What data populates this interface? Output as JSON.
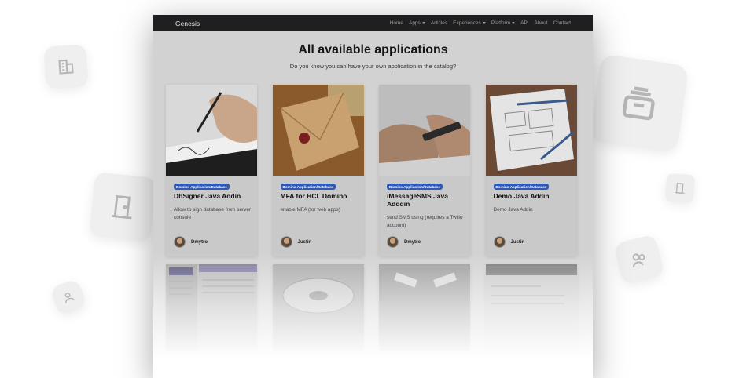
{
  "navbar": {
    "brand": "Genesis",
    "links": [
      {
        "label": "Home"
      },
      {
        "label": "Apps"
      },
      {
        "label": "Articles"
      },
      {
        "label": "Experiences"
      },
      {
        "label": "Platform"
      },
      {
        "label": "API"
      },
      {
        "label": "About"
      },
      {
        "label": "Contact"
      }
    ]
  },
  "hero": {
    "title": "All available applications",
    "subtitle": "Do you know you can have your own application in the catalog?"
  },
  "cards": [
    {
      "badge": "Domino Application/Database",
      "title": "DbSigner Java Addin",
      "description": "Allow to sign database from server console",
      "author": "Dmytro"
    },
    {
      "badge": "Domino Application/Database",
      "title": "MFA for HCL Domino",
      "description": "enable MFA (for web apps)",
      "author": "Justin"
    },
    {
      "badge": "Domino Application/Database",
      "title": "iMessageSMS Java Adddin",
      "description": "send SMS using (requires a Twilio account)",
      "author": "Dmytro"
    },
    {
      "badge": "Domino Application/Database",
      "title": "Demo Java Addin",
      "description": "Demo Java Addin",
      "author": "Justin"
    }
  ],
  "icons": {
    "tile_top_left": "building-icon",
    "tile_mid_left": "door-icon",
    "tile_bottom_left": "user-icon",
    "tile_top_right": "folder-stack-icon",
    "tile_mid_right": "door-icon",
    "tile_bottom_right": "users-icon"
  }
}
